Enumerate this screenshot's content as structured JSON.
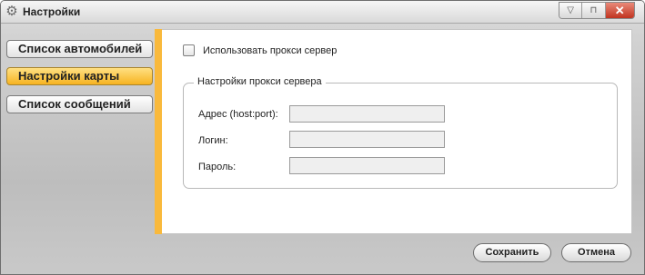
{
  "window": {
    "title": "Настройки",
    "title_icon": "gear-icon",
    "controls": {
      "minimize": "▽",
      "restore": "⊓",
      "close": "✕"
    }
  },
  "sidebar": {
    "items": [
      {
        "label": "Список автомобилей",
        "active": false
      },
      {
        "label": "Настройки карты",
        "active": true
      },
      {
        "label": "Список сообщений",
        "active": false
      }
    ]
  },
  "panel": {
    "proxy_checkbox": {
      "label": "Использовать прокси сервер",
      "checked": false
    },
    "group": {
      "legend": "Настройки прокси сервера",
      "fields": [
        {
          "label": "Адрес (host:port):",
          "value": ""
        },
        {
          "label": "Логин:",
          "value": ""
        },
        {
          "label": "Пароль:",
          "value": ""
        }
      ]
    }
  },
  "footer": {
    "save_label": "Сохранить",
    "cancel_label": "Отмена"
  },
  "colors": {
    "accent": "#f9b93c",
    "active_tab": "#f7b320",
    "close_button": "#c0331f"
  }
}
